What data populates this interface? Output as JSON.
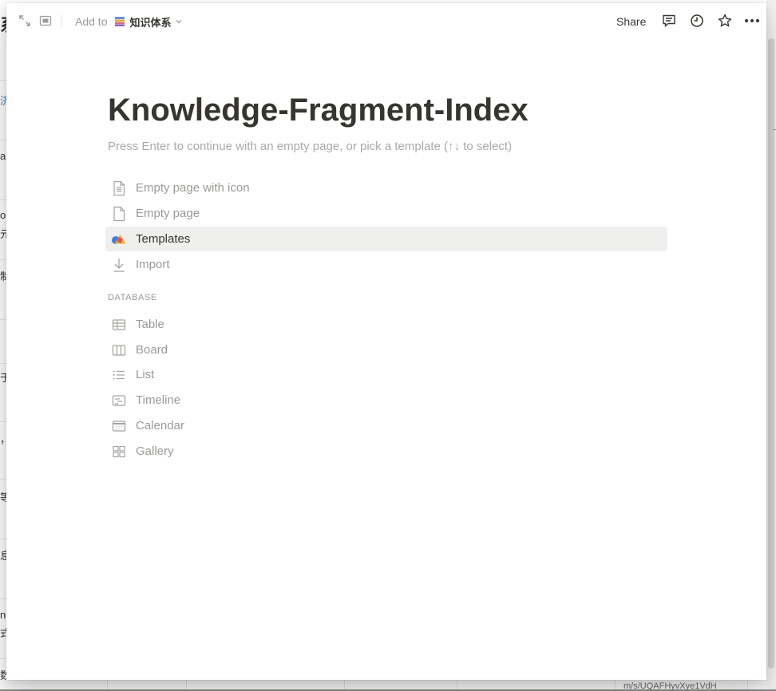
{
  "modal": {
    "add_to_label": "Add to",
    "workspace_name": "知识体系",
    "share_label": "Share",
    "page_title": "Knowledge-Fragment-Index",
    "hint": "Press Enter to continue with an empty page, or pick a template (↑↓ to select)",
    "options": [
      {
        "label": "Empty page with icon",
        "icon": "page-with-icon-icon"
      },
      {
        "label": "Empty page",
        "icon": "page-icon"
      },
      {
        "label": "Templates",
        "icon": "templates-icon",
        "highlighted": true
      },
      {
        "label": "Import",
        "icon": "import-icon"
      }
    ],
    "database_section_label": "DATABASE",
    "database_options": [
      {
        "label": "Table",
        "icon": "table-icon"
      },
      {
        "label": "Board",
        "icon": "board-icon"
      },
      {
        "label": "List",
        "icon": "list-icon"
      },
      {
        "label": "Timeline",
        "icon": "timeline-icon"
      },
      {
        "label": "Calendar",
        "icon": "calendar-icon"
      },
      {
        "label": "Gallery",
        "icon": "gallery-icon"
      }
    ]
  },
  "background": {
    "fragments": [
      "系",
      "济",
      "a",
      "oc",
      "元",
      "制",
      "于",
      "，",
      "等",
      "息",
      "ng",
      "式",
      "数"
    ],
    "bottom_url": "m/s/UQAFHyvXye1VdH"
  },
  "colors": {
    "text_primary": "#37352f",
    "text_secondary": "#9b9a97",
    "highlight": "#efefed"
  }
}
